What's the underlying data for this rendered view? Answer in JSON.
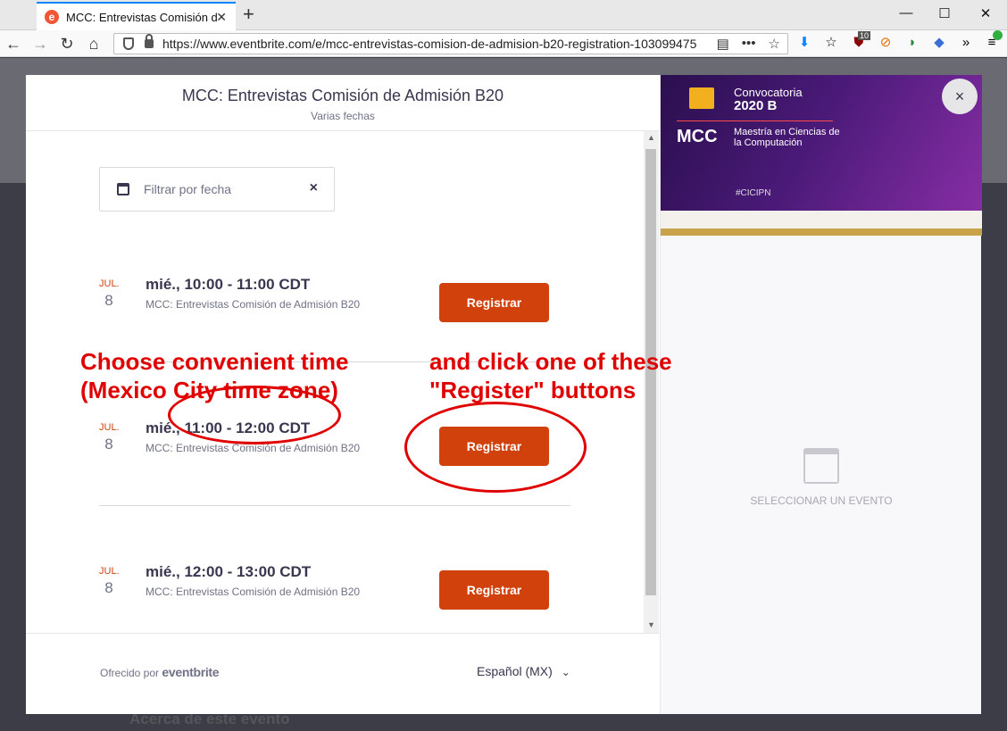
{
  "browser": {
    "tab_title": "MCC: Entrevistas Comisión de",
    "tab_favicon": "e",
    "url": "https://www.eventbrite.com/e/mcc-entrevistas-comision-de-admision-b20-registration-103099475",
    "icons": [
      "back-icon",
      "forward-icon",
      "reload-icon",
      "home-icon",
      "shield-icon",
      "lock-icon",
      "reader-icon",
      "more-icon",
      "star-icon"
    ],
    "extension_badge": "10",
    "brand_color": "#f05537"
  },
  "modal": {
    "title": "MCC: Entrevistas Comisión de Admisión B20",
    "subtitle": "Varias fechas",
    "filter_placeholder": "Filtrar por fecha",
    "clear_icon": "×",
    "events": [
      {
        "month": "JUL.",
        "day": "8",
        "time": "mié., 10:00 - 11:00 CDT",
        "name": "MCC: Entrevistas Comisión de Admisión B20",
        "button": "Registrar"
      },
      {
        "month": "JUL.",
        "day": "8",
        "time": "mié., 11:00 - 12:00 CDT",
        "name": "MCC: Entrevistas Comisión de Admisión B20",
        "button": "Registrar"
      },
      {
        "month": "JUL.",
        "day": "8",
        "time": "mié., 12:00 - 13:00 CDT",
        "name": "MCC: Entrevistas Comisión de Admisión B20",
        "button": "Registrar"
      }
    ],
    "footer": {
      "powered_prefix": "Ofrecido por",
      "powered_brand": "eventbrite",
      "language": "Español (MX)"
    },
    "accent_color": "#d1410c"
  },
  "banner": {
    "convocatoria": "Convocatoria",
    "year": "2020 B",
    "mcc": "MCC",
    "degree": "Maestría en Ciencias de la Computación",
    "hashtag": "#CICIPN"
  },
  "right_panel": {
    "empty_text": "SELECCIONAR UN EVENTO",
    "close_label": "×"
  },
  "background_page": {
    "section_title": "Acerca de este evento"
  },
  "annotations": {
    "left": "Choose convenient time\n(Mexico City time zone)",
    "right": "and click one of these\n\"Register\" buttons",
    "color": "#e00000"
  }
}
